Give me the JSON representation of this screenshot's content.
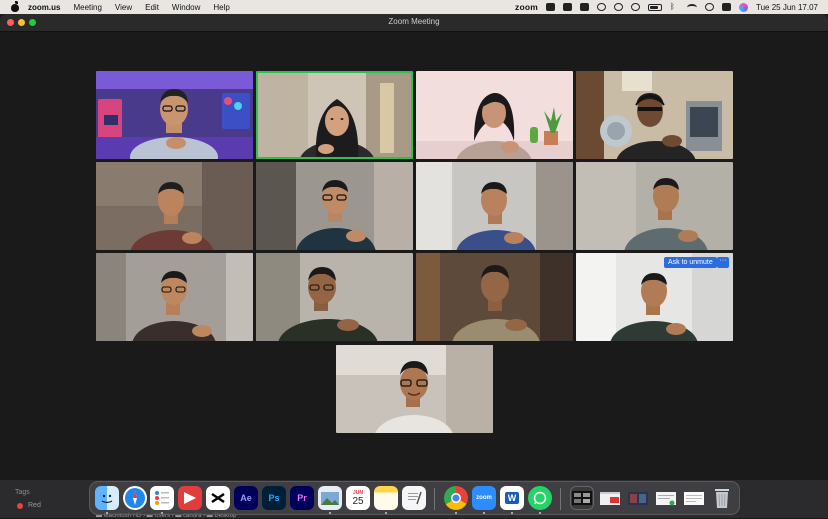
{
  "menubar": {
    "app_name": "zoom.us",
    "menus": [
      "Meeting",
      "View",
      "Edit",
      "Window",
      "Help"
    ],
    "status_logo": "zoom",
    "clock": "Tue 25 Jun  17.07"
  },
  "window": {
    "title": "Zoom Meeting"
  },
  "gallery": {
    "speaking_index": 1,
    "unmute_tile_index": 11,
    "unmute_label": "Ask to unmute",
    "more_label": "···"
  },
  "finder": {
    "tags_label": "Tags",
    "tag_red": "Red",
    "path": "▬ Macintosh HD  ›  ▬ Users  ›  ▬ candra  ›  ▬ Desktop"
  },
  "dock": {
    "apps": [
      {
        "name": "Finder",
        "icon": "finder-icon"
      },
      {
        "name": "Safari",
        "icon": "safari-icon"
      },
      {
        "name": "Reminders",
        "icon": "reminders-icon"
      },
      {
        "name": "Presentation",
        "icon": "presentation-icon"
      },
      {
        "name": "CapCut",
        "icon": "capcut-icon"
      },
      {
        "name": "After Effects",
        "icon": "after-effects-icon",
        "label": "Ae"
      },
      {
        "name": "Photoshop",
        "icon": "photoshop-icon",
        "label": "Ps"
      },
      {
        "name": "Premiere Pro",
        "icon": "premiere-icon",
        "label": "Pr"
      },
      {
        "name": "Preview",
        "icon": "preview-icon"
      },
      {
        "name": "Calendar",
        "icon": "calendar-icon",
        "label": "25",
        "month": "JUN"
      },
      {
        "name": "Notes",
        "icon": "notes-icon"
      },
      {
        "name": "TextEdit",
        "icon": "textedit-icon"
      },
      {
        "name": "Chrome",
        "icon": "chrome-icon"
      },
      {
        "name": "Zoom",
        "icon": "zoom-icon",
        "label": "zoom"
      },
      {
        "name": "Word",
        "icon": "word-icon",
        "label": "W"
      },
      {
        "name": "WhatsApp",
        "icon": "whatsapp-icon"
      },
      {
        "name": "Screenshot",
        "icon": "screenshot-thumb-icon"
      },
      {
        "name": "Recent 1",
        "icon": "recent-window-icon"
      },
      {
        "name": "Recent 2",
        "icon": "recent-window-icon"
      },
      {
        "name": "Recent 3",
        "icon": "recent-window-icon"
      },
      {
        "name": "Recent 4",
        "icon": "recent-window-icon"
      },
      {
        "name": "Trash",
        "icon": "trash-icon"
      }
    ]
  }
}
